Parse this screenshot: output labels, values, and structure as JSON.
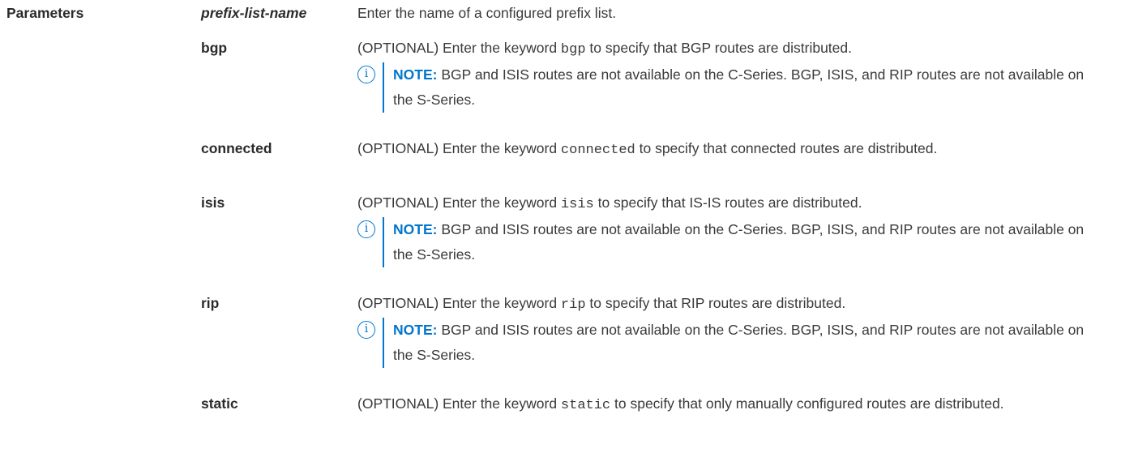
{
  "section": {
    "label": "Parameters"
  },
  "params": [
    {
      "term": "prefix-list-name",
      "italic": true,
      "pre": "Enter the name of a configured prefix list.",
      "keyword": "",
      "post": "",
      "note": null
    },
    {
      "term": "bgp",
      "italic": false,
      "pre": "(OPTIONAL) Enter the keyword ",
      "keyword": "bgp",
      "post": " to specify that BGP routes are distributed.",
      "note": {
        "label": "NOTE:",
        "text": " BGP and ISIS routes are not available on the C-Series. BGP, ISIS, and RIP routes are not available on the S-Series."
      }
    },
    {
      "term": "connected",
      "italic": false,
      "pre": "(OPTIONAL) Enter the keyword ",
      "keyword": "connected",
      "post": " to specify that connected routes are distributed.",
      "note": null
    },
    {
      "term": "isis",
      "italic": false,
      "pre": "(OPTIONAL) Enter the keyword ",
      "keyword": "isis",
      "post": " to specify that IS-IS routes are distributed.",
      "note": {
        "label": "NOTE:",
        "text": " BGP and ISIS routes are not available on the C-Series. BGP, ISIS, and RIP routes are not available on the S-Series."
      }
    },
    {
      "term": "rip",
      "italic": false,
      "pre": "(OPTIONAL) Enter the keyword ",
      "keyword": "rip",
      "post": " to specify that RIP routes are distributed.",
      "note": {
        "label": "NOTE:",
        "text": " BGP and ISIS routes are not available on the C-Series. BGP, ISIS, and RIP routes are not available on the S-Series."
      }
    },
    {
      "term": "static",
      "italic": false,
      "pre": "(OPTIONAL) Enter the keyword ",
      "keyword": "static",
      "post": " to specify that only manually configured routes are distributed.",
      "note": null
    }
  ],
  "note_icon": "info-icon",
  "colors": {
    "accent": "#0076ce",
    "text": "#2b2b2b"
  }
}
